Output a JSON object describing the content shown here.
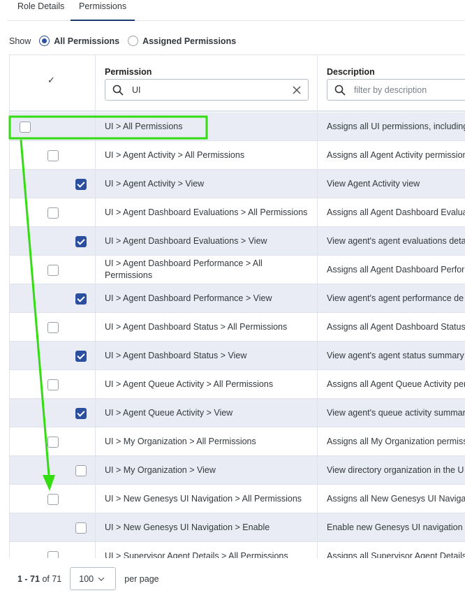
{
  "tabs": [
    "Role Details",
    "Permissions"
  ],
  "show": {
    "label": "Show",
    "options": [
      {
        "label": "All Permissions",
        "selected": true
      },
      {
        "label": "Assigned Permissions",
        "selected": false
      }
    ]
  },
  "table": {
    "header_check": "✓",
    "columns": [
      {
        "title": "Permission",
        "value": "UI",
        "placeholder": ""
      },
      {
        "title": "Description",
        "value": "",
        "placeholder": "filter by description"
      }
    ],
    "rows": [
      {
        "level": 0,
        "checked": false,
        "permission": "UI > All Permissions",
        "description": "Assigns all UI permissions, including"
      },
      {
        "level": 1,
        "checked": false,
        "permission": "UI > Agent Activity > All Permissions",
        "description": "Assigns all Agent Activity permission"
      },
      {
        "level": 2,
        "checked": true,
        "permission": "UI > Agent Activity > View",
        "description": "View Agent Activity view"
      },
      {
        "level": 1,
        "checked": false,
        "permission": "UI > Agent Dashboard Evaluations > All Permissions",
        "description": "Assigns all Agent Dashboard Evalua"
      },
      {
        "level": 2,
        "checked": true,
        "permission": "UI > Agent Dashboard Evaluations > View",
        "description": "View agent's agent evaluations deta"
      },
      {
        "level": 1,
        "checked": false,
        "permission": "UI > Agent Dashboard Performance > All Permissions",
        "description": "Assigns all Agent Dashboard Perfor"
      },
      {
        "level": 2,
        "checked": true,
        "permission": "UI > Agent Dashboard Performance > View",
        "description": "View agent's agent performance de"
      },
      {
        "level": 1,
        "checked": false,
        "permission": "UI > Agent Dashboard Status > All Permissions",
        "description": "Assigns all Agent Dashboard Status"
      },
      {
        "level": 2,
        "checked": true,
        "permission": "UI > Agent Dashboard Status > View",
        "description": "View agent's agent status summary"
      },
      {
        "level": 1,
        "checked": false,
        "permission": "UI > Agent Queue Activity > All Permissions",
        "description": "Assigns all Agent Queue Activity per"
      },
      {
        "level": 2,
        "checked": true,
        "permission": "UI > Agent Queue Activity > View",
        "description": "View agent's queue activity summar"
      },
      {
        "level": 1,
        "checked": false,
        "permission": "UI > My Organization > All Permissions",
        "description": "Assigns all My Organization permiss"
      },
      {
        "level": 2,
        "checked": false,
        "permission": "UI > My Organization > View",
        "description": "View directory organization in the U"
      },
      {
        "level": 1,
        "checked": false,
        "permission": "UI > New Genesys UI Navigation > All Permissions",
        "description": "Assigns all New Genesys UI Navigat"
      },
      {
        "level": 2,
        "checked": false,
        "permission": "UI > New Genesys UI Navigation > Enable",
        "description": "Enable new Genesys UI navigation"
      },
      {
        "level": 1,
        "checked": false,
        "permission": "UI > Supervisor Agent Details > All Permissions",
        "description": "Assigns all Supervisor Agent Details"
      }
    ]
  },
  "footer": {
    "range": "1 - 71",
    "of": "of 71",
    "page_size": "100",
    "per_page": "per page"
  },
  "colors": {
    "accent": "#2b4e9e",
    "annotation": "#33dd11",
    "row_shade": "#e9ecf4"
  }
}
